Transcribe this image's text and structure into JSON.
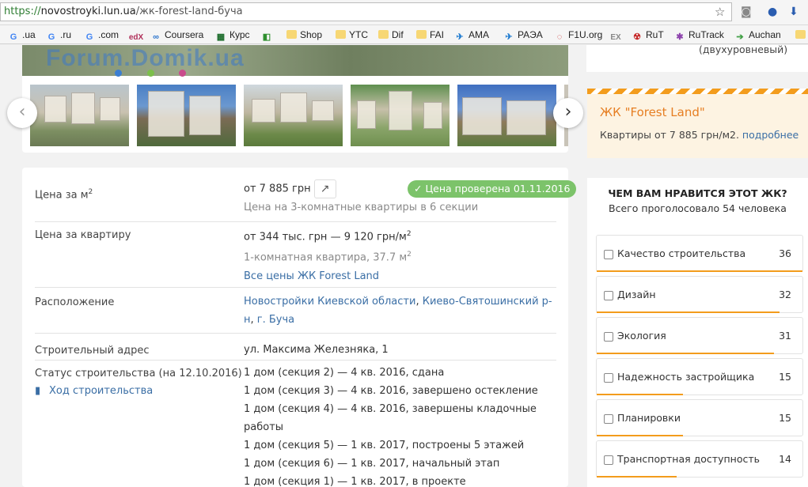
{
  "browser": {
    "url_scheme": "https://",
    "url_host": "novostroyki.lun.ua",
    "url_path": "/жк-forest-land-буча",
    "icons": [
      "star-icon",
      "camera-icon",
      "microphone-icon",
      "download-icon"
    ]
  },
  "bookmarks": [
    {
      "label": ".ua",
      "icon": "G"
    },
    {
      "label": ".ru",
      "icon": "G"
    },
    {
      "label": ".com",
      "icon": "G"
    },
    {
      "label": "",
      "icon": "edX"
    },
    {
      "label": "Coursera",
      "icon": "∞"
    },
    {
      "label": "Курс",
      "icon": "▦"
    },
    {
      "label": "",
      "icon": "◧"
    },
    {
      "label": "Shop",
      "icon": "folder"
    },
    {
      "label": "YTC",
      "icon": "folder"
    },
    {
      "label": "Dif",
      "icon": "folder"
    },
    {
      "label": "FAI",
      "icon": "folder"
    },
    {
      "label": "AMA",
      "icon": "✈"
    },
    {
      "label": "PAЭA",
      "icon": "✈"
    },
    {
      "label": "F1U.org",
      "icon": "◌"
    },
    {
      "label": "",
      "icon": "EX"
    },
    {
      "label": "RuT",
      "icon": "☢"
    },
    {
      "label": "RuTrack",
      "icon": "✱"
    },
    {
      "label": "Auchan",
      "icon": "➔"
    }
  ],
  "gallery": {
    "watermark": "Forum.Domik.ua",
    "prev": "‹",
    "next": "›"
  },
  "info": {
    "price_m2": {
      "label": "Цена за м",
      "value": "от 7 885 грн",
      "note": "Цена на 3-комнатные квартиры в 6 секции",
      "verified": "✓ Цена проверена 01.11.2016"
    },
    "price_flat": {
      "label": "Цена за квартиру",
      "value_a": "от 344 тыс. грн — 9 120 грн/м",
      "note": "1-комнатная квартира, 37.7 м",
      "link": "Все цены ЖК Forest Land"
    },
    "location": {
      "label": "Расположение",
      "link1": "Новостройки Киевской области",
      "sep": ", ",
      "link2": "Киево-Святошинский р-н",
      "sep2": ", ",
      "link3": "г. Буча"
    },
    "address": {
      "label": "Строительный адрес",
      "value": "ул. Максима Железняка, 1"
    },
    "status": {
      "label": "Статус строительства (на 12.10.2016)",
      "progress_link": "Ход строительства",
      "lines": [
        "1 дом (секция 2) — 4 кв. 2016, сдана",
        "1 дом (секция 3) — 4 кв. 2016, завершено остекление",
        "1 дом (секция 4) — 4 кв. 2016, завершены кладочные работы",
        "1 дом (секция 5) — 1 кв. 2017, построены 5 этажей",
        "1 дом (секция 6) — 1 кв. 2017, начальный этап",
        "1 дом (секция 1) — 1 кв. 2017, в проекте"
      ]
    }
  },
  "right_top": "(двухуровневый)",
  "promo": {
    "title": "ЖК \"Forest Land\"",
    "text": "Квартиры от 7 885 грн/м2.",
    "link": "подробнее"
  },
  "poll": {
    "title": "ЧЕМ ВАМ НРАВИТСЯ ЭТОТ ЖК?",
    "subtitle": "Всего проголосовало 54 человека",
    "accent": "#f39c1c",
    "items": [
      {
        "label": "Качество строительства",
        "count": "36",
        "share": 1.0
      },
      {
        "label": "Дизайн",
        "count": "32",
        "share": 0.89
      },
      {
        "label": "Экология",
        "count": "31",
        "share": 0.86
      },
      {
        "label": "Надежность застройщика",
        "count": "15",
        "share": 0.42
      },
      {
        "label": "Планировки",
        "count": "15",
        "share": 0.42
      },
      {
        "label": "Транспортная доступность",
        "count": "14",
        "share": 0.39
      }
    ]
  }
}
